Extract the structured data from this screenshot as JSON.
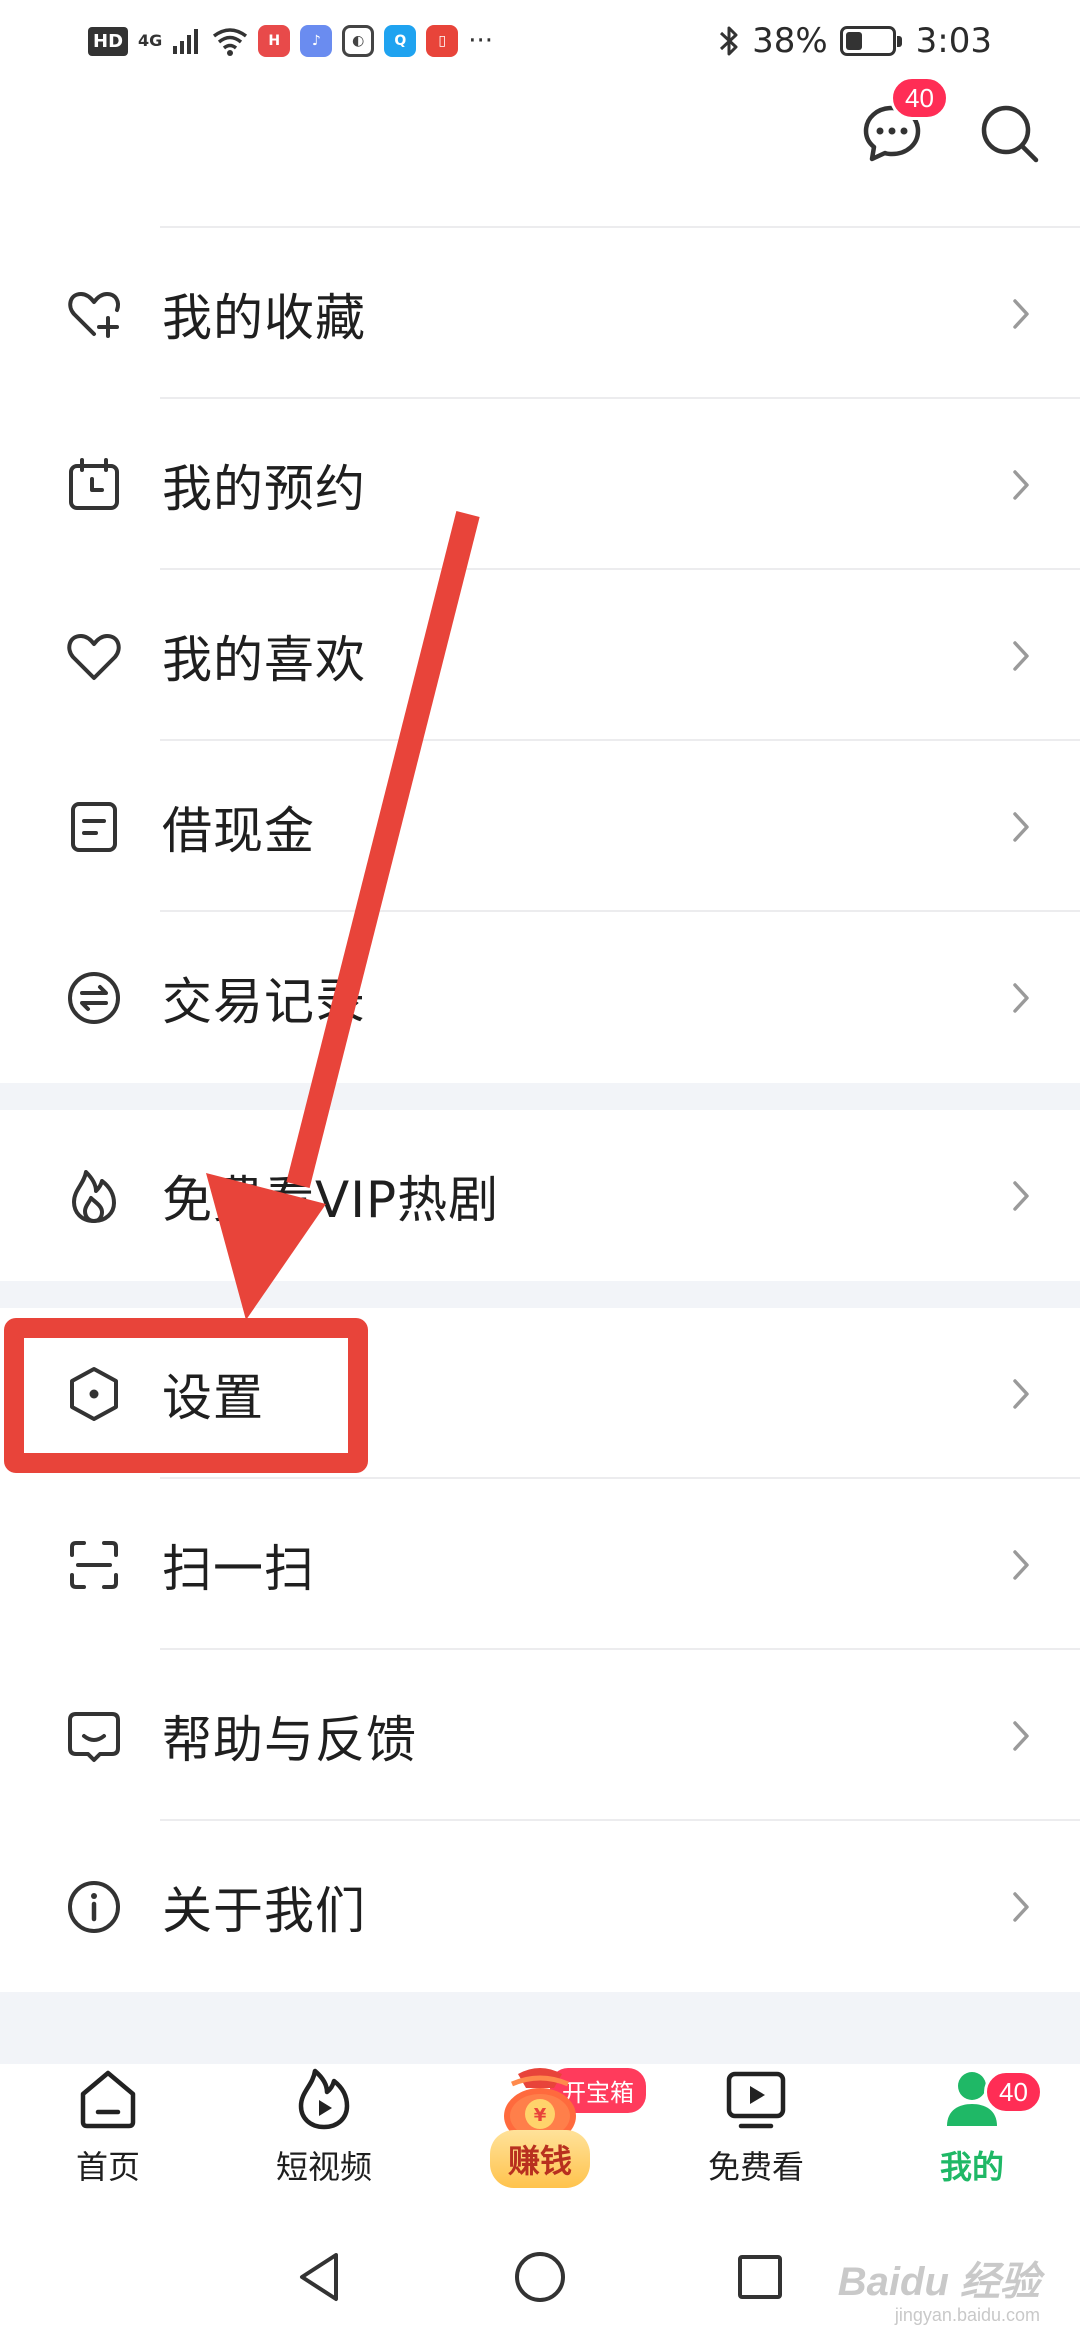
{
  "status_bar": {
    "hd": "HD",
    "network": "4G",
    "battery_percent": "38%",
    "battery_level": 0.38,
    "time": "3:03",
    "more": "···"
  },
  "top_actions": {
    "message_badge": "40"
  },
  "menu": {
    "group1": [
      {
        "label": "我的收藏",
        "icon": "heart-plus-icon"
      },
      {
        "label": "我的预约",
        "icon": "calendar-icon"
      },
      {
        "label": "我的喜欢",
        "icon": "heart-icon"
      },
      {
        "label": "借现金",
        "icon": "document-icon"
      },
      {
        "label": "交易记录",
        "icon": "exchange-icon"
      }
    ],
    "group2": [
      {
        "label": "免费看VIP热剧",
        "icon": "flame-icon"
      }
    ],
    "group3": [
      {
        "label": "设置",
        "icon": "settings-hexagon-icon"
      },
      {
        "label": "扫一扫",
        "icon": "scan-icon"
      },
      {
        "label": "帮助与反馈",
        "icon": "feedback-icon"
      },
      {
        "label": "关于我们",
        "icon": "info-icon"
      }
    ]
  },
  "bottom_nav": {
    "items": [
      {
        "label": "首页",
        "icon": "home-icon"
      },
      {
        "label": "短视频",
        "icon": "flame-play-icon"
      },
      {
        "label": "赚钱",
        "icon": "money-bag-icon",
        "tag": "开宝箱"
      },
      {
        "label": "免费看",
        "icon": "tv-play-icon"
      },
      {
        "label": "我的",
        "icon": "person-icon",
        "badge": "40"
      }
    ],
    "active": "我的"
  },
  "watermark": {
    "brand": "Baidu 经验",
    "url": "jingyan.baidu.com"
  },
  "colors": {
    "accent_green": "#1fb866",
    "badge_red": "#ff2d55",
    "annotation_red": "#e8443a",
    "section_gap": "#f2f4f8"
  }
}
